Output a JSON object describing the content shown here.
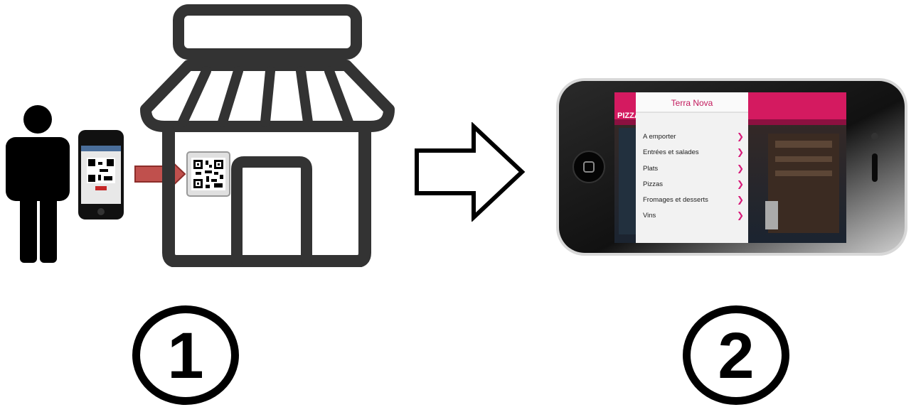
{
  "steps": {
    "first": "1",
    "second": "2"
  },
  "phone_app": {
    "title": "Terra Nova",
    "menu_items": [
      "A emporter",
      "Entrées et salades",
      "Plats",
      "Pizzas",
      "Fromages et desserts",
      "Vins"
    ],
    "chevron": "❯",
    "accent_color": "#d81b7a"
  },
  "icons": [
    "person-icon",
    "scanner-phone-icon",
    "red-arrow-icon",
    "store-icon",
    "qr-code-icon",
    "flow-arrow-icon",
    "menu-phone-icon"
  ],
  "colors": {
    "store": "#333333",
    "red_arrow": "#c0504d",
    "awning": "#d41a60"
  }
}
